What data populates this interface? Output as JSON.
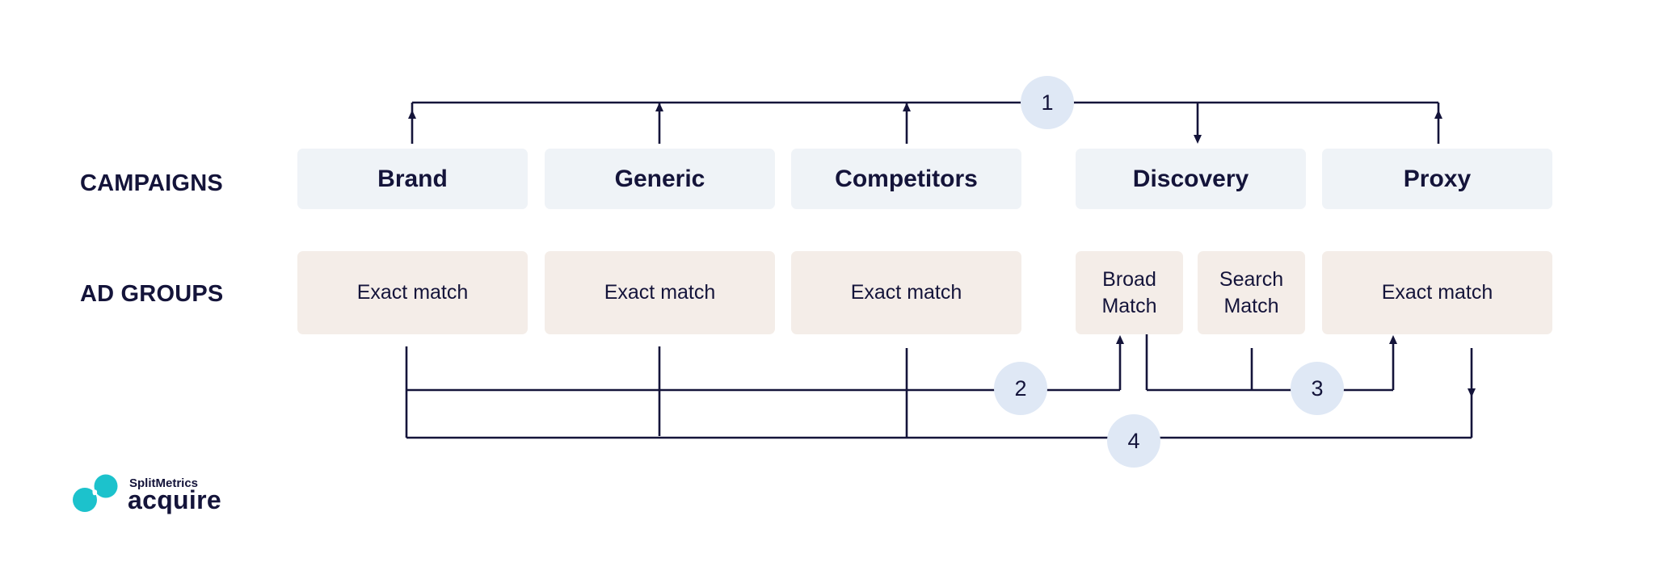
{
  "row_labels": {
    "campaigns": "CAMPAIGNS",
    "ad_groups": "AD GROUPS"
  },
  "campaigns": [
    {
      "id": "brand",
      "label": "Brand"
    },
    {
      "id": "generic",
      "label": "Generic"
    },
    {
      "id": "competitors",
      "label": "Competitors"
    },
    {
      "id": "discovery",
      "label": "Discovery"
    },
    {
      "id": "proxy",
      "label": "Proxy"
    }
  ],
  "ad_groups": [
    {
      "campaign": "brand",
      "label": "Exact match"
    },
    {
      "campaign": "generic",
      "label": "Exact match"
    },
    {
      "campaign": "competitors",
      "label": "Exact match"
    },
    {
      "campaign": "discovery",
      "label": "Broad Match"
    },
    {
      "campaign": "discovery",
      "label": "Search Match"
    },
    {
      "campaign": "proxy",
      "label": "Exact match"
    }
  ],
  "flow_steps": [
    {
      "number": "1",
      "description": "Discovery campaign feeds keywords to Brand, Generic, Competitors and Proxy campaigns"
    },
    {
      "number": "2",
      "description": "Exact match ad groups of Brand, Generic and Competitors feed into Discovery Broad Match"
    },
    {
      "number": "3",
      "description": "Discovery Broad Match and Search Match feed into Proxy Exact match"
    },
    {
      "number": "4",
      "description": "Proxy Exact match feeds back to Brand, Generic and Competitors"
    }
  ],
  "logo": {
    "brand": "SplitMetrics",
    "product": "acquire"
  },
  "colors": {
    "ink": "#14143a",
    "campaign_bg": "#eff3f7",
    "ad_group_bg": "#f4ede8",
    "badge_bg": "#dfe8f5",
    "logo_teal": "#1cc2cc"
  }
}
